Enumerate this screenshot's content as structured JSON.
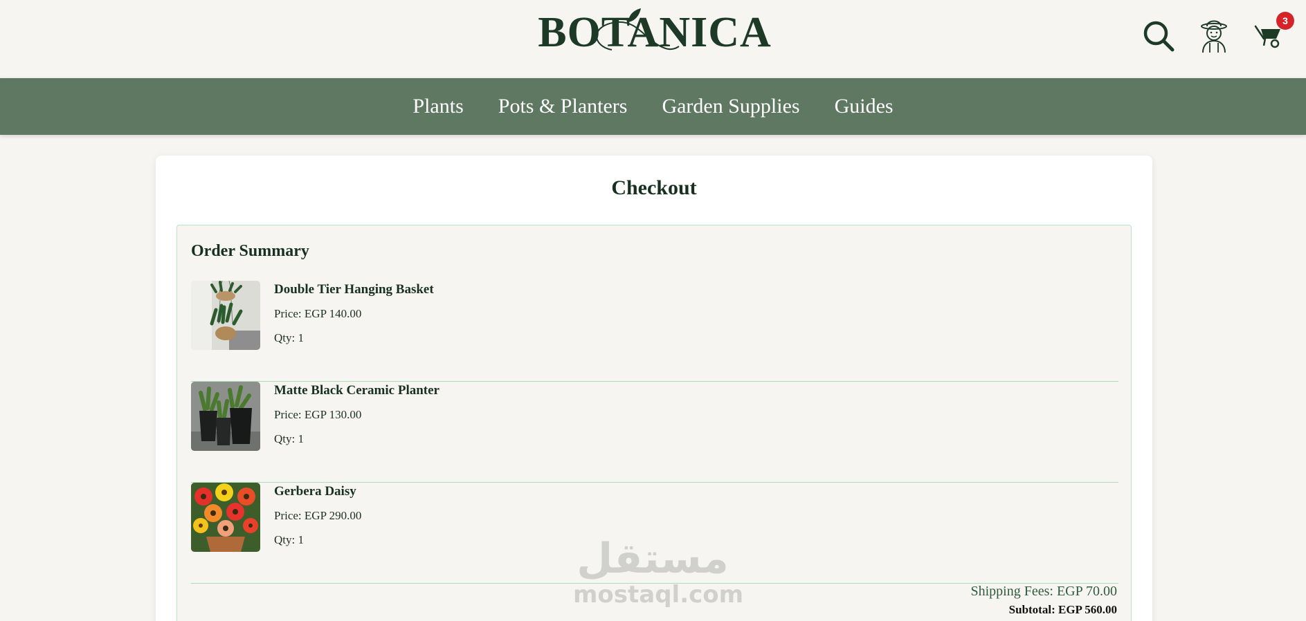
{
  "brand": {
    "name": "BOTANICA"
  },
  "header": {
    "cart_count": "3",
    "icons": [
      "search-icon",
      "gardener-avatar-icon",
      "wheelbarrow-cart-icon"
    ]
  },
  "nav": {
    "items": [
      "Plants",
      "Pots & Planters",
      "Garden Supplies",
      "Guides"
    ]
  },
  "checkout": {
    "title": "Checkout",
    "summary_title": "Order Summary",
    "items": [
      {
        "name": "Double Tier Hanging Basket",
        "price": "Price: EGP 140.00",
        "qty": "Qty: 1"
      },
      {
        "name": "Matte Black Ceramic Planter",
        "price": "Price: EGP 130.00",
        "qty": "Qty: 1"
      },
      {
        "name": "Gerbera Daisy",
        "price": "Price: EGP 290.00",
        "qty": "Qty: 1"
      }
    ],
    "shipping": "Shipping Fees: EGP 70.00",
    "subtotal": "Subtotal: EGP 560.00"
  },
  "watermark": {
    "arabic": "مستقل",
    "latin": "mostaql.com"
  },
  "colors": {
    "nav_bg": "#5e7862",
    "brand_green": "#1c3a26",
    "badge_red": "#d5232a",
    "summary_border": "#b7e4c4"
  }
}
